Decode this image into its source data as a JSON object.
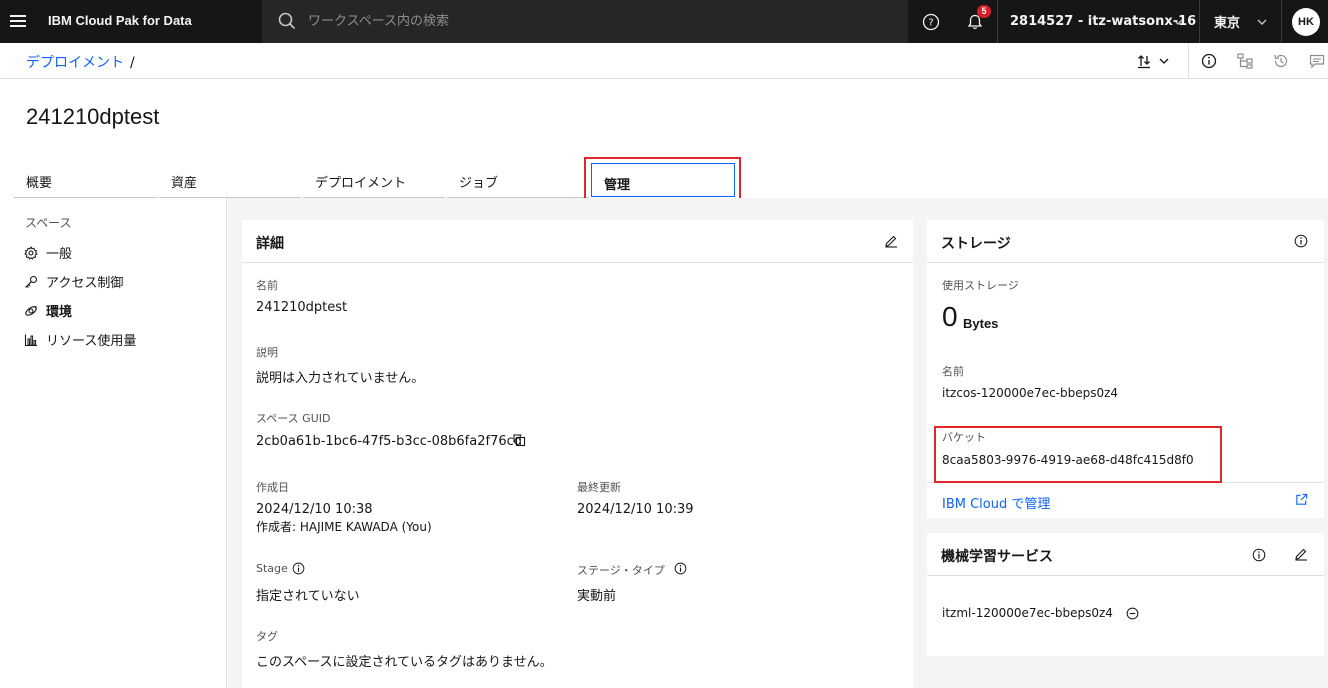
{
  "header": {
    "brand": "IBM Cloud Pak for Data",
    "search_placeholder": "ワークスペース内の検索",
    "notification_count": "5",
    "account": "2814527 - itz-watsonx-16",
    "region": "東京",
    "avatar_initials": "HK"
  },
  "breadcrumb": {
    "parent": "デプロイメント",
    "separator": "/"
  },
  "page": {
    "title": "241210dptest"
  },
  "tabs": [
    {
      "label": "概要"
    },
    {
      "label": "資産"
    },
    {
      "label": "デプロイメント"
    },
    {
      "label": "ジョブ"
    },
    {
      "label": "管理",
      "active": true
    }
  ],
  "sidenav": {
    "section_title": "スペース",
    "items": [
      {
        "label": "一般",
        "icon": "gear-icon"
      },
      {
        "label": "アクセス制御",
        "icon": "key-icon"
      },
      {
        "label": "環境",
        "icon": "environment-icon"
      },
      {
        "label": "リソース使用量",
        "icon": "bar-chart-icon"
      }
    ]
  },
  "details": {
    "title": "詳細",
    "name_label": "名前",
    "name_value": "241210dptest",
    "description_label": "説明",
    "description_value": "説明は入力されていません。",
    "guid_label": "スペース GUID",
    "guid_value": "2cb0a61b-1bc6-47f5-b3cc-08b6fa2f76cd",
    "created_label": "作成日",
    "created_value": "2024/12/10 10:38",
    "creator_value": "作成者: HAJIME KAWADA (You)",
    "updated_label": "最終更新",
    "updated_value": "2024/12/10 10:39",
    "stage_label": "Stage",
    "stage_value": "指定されていない",
    "stage_type_label": "ステージ・タイプ",
    "stage_type_value": "実動前",
    "tags_label": "タグ",
    "tags_value": "このスペースに設定されているタグはありません。"
  },
  "storage": {
    "title": "ストレージ",
    "used_label": "使用ストレージ",
    "used_value": "0",
    "used_unit": "Bytes",
    "name_label": "名前",
    "name_value": "itzcos-120000e7ec-bbeps0z4",
    "bucket_label": "バケット",
    "bucket_value": "8caa5803-9976-4919-ae68-d48fc415d8f0",
    "manage_link": "IBM Cloud で管理"
  },
  "ml_service": {
    "title": "機械学習サービス",
    "instance": "itzml-120000e7ec-bbeps0z4"
  },
  "colors": {
    "nav_bg": "#161616",
    "accent": "#0f62fe",
    "highlight": "#e12828",
    "badge": "#da1e28"
  }
}
